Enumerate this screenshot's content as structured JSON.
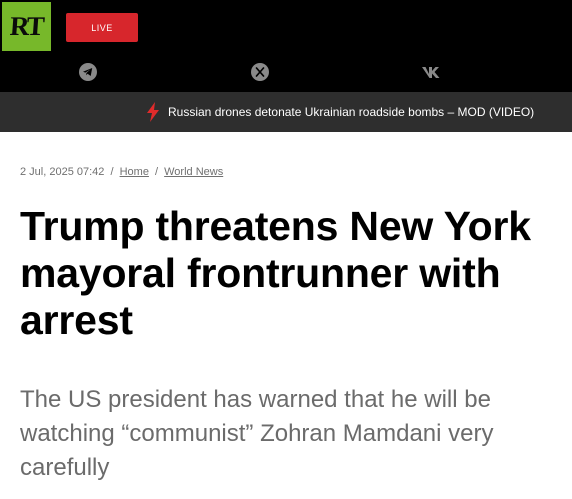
{
  "header": {
    "logo_text": "RT",
    "live_label": "LIVE",
    "colors": {
      "logo_bg": "#77b82a",
      "live_bg": "#d7262c",
      "header_bg": "#000000"
    },
    "social_icons": [
      "telegram-icon",
      "x-icon",
      "vk-icon"
    ]
  },
  "ticker": {
    "icon": "lightning-bolt-icon",
    "text": "Russian drones detonate Ukrainian roadside bombs – MOD (VIDEO)"
  },
  "article": {
    "date": "2 Jul, 2025 07:42",
    "breadcrumb": [
      "Home",
      "World News"
    ],
    "separator": "/",
    "title": "Trump threatens New York mayoral frontrunner with arrest",
    "summary": "The US president has warned that he will be watching “communist” Zohran Mamdani very carefully"
  }
}
